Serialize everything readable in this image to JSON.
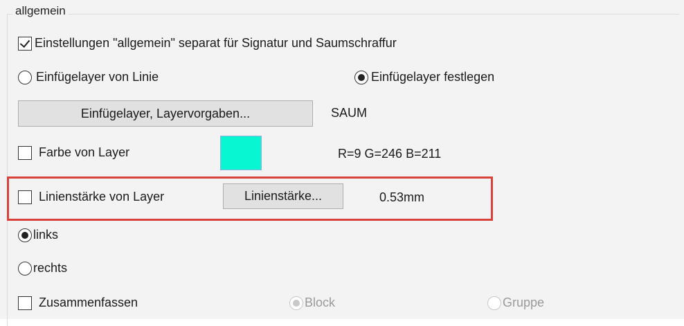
{
  "group": {
    "label": "allgemein"
  },
  "separate_settings": {
    "label": "Einstellungen \"allgemein\" separat für Signatur und Saumschraffur",
    "checked": true
  },
  "insert_layer_from_line": {
    "label": "Einfügelayer von Linie",
    "checked": false
  },
  "insert_layer_fixed": {
    "label": "Einfügelayer festlegen",
    "checked": true
  },
  "layer_button": {
    "label": "Einfügelayer, Layervorgaben..."
  },
  "layer_name": "SAUM",
  "color_from_layer": {
    "label": "Farbe von Layer",
    "checked": false
  },
  "color_swatch": {
    "color": "#09F6D3"
  },
  "color_value": "R=9 G=246 B=211",
  "lineweight_from_layer": {
    "label": "Linienstärke von Layer",
    "checked": false
  },
  "lineweight_button": {
    "label": "Linienstärke..."
  },
  "lineweight_value": "0.53mm",
  "highlight_color": "#d9413b",
  "side_left": {
    "label": "links",
    "checked": true
  },
  "side_right": {
    "label": "rechts",
    "checked": false
  },
  "combine": {
    "label": "Zusammenfassen",
    "checked": false
  },
  "combine_block": {
    "label": "Block",
    "checked": true,
    "enabled": false
  },
  "combine_group": {
    "label": "Gruppe",
    "checked": false,
    "enabled": false
  }
}
